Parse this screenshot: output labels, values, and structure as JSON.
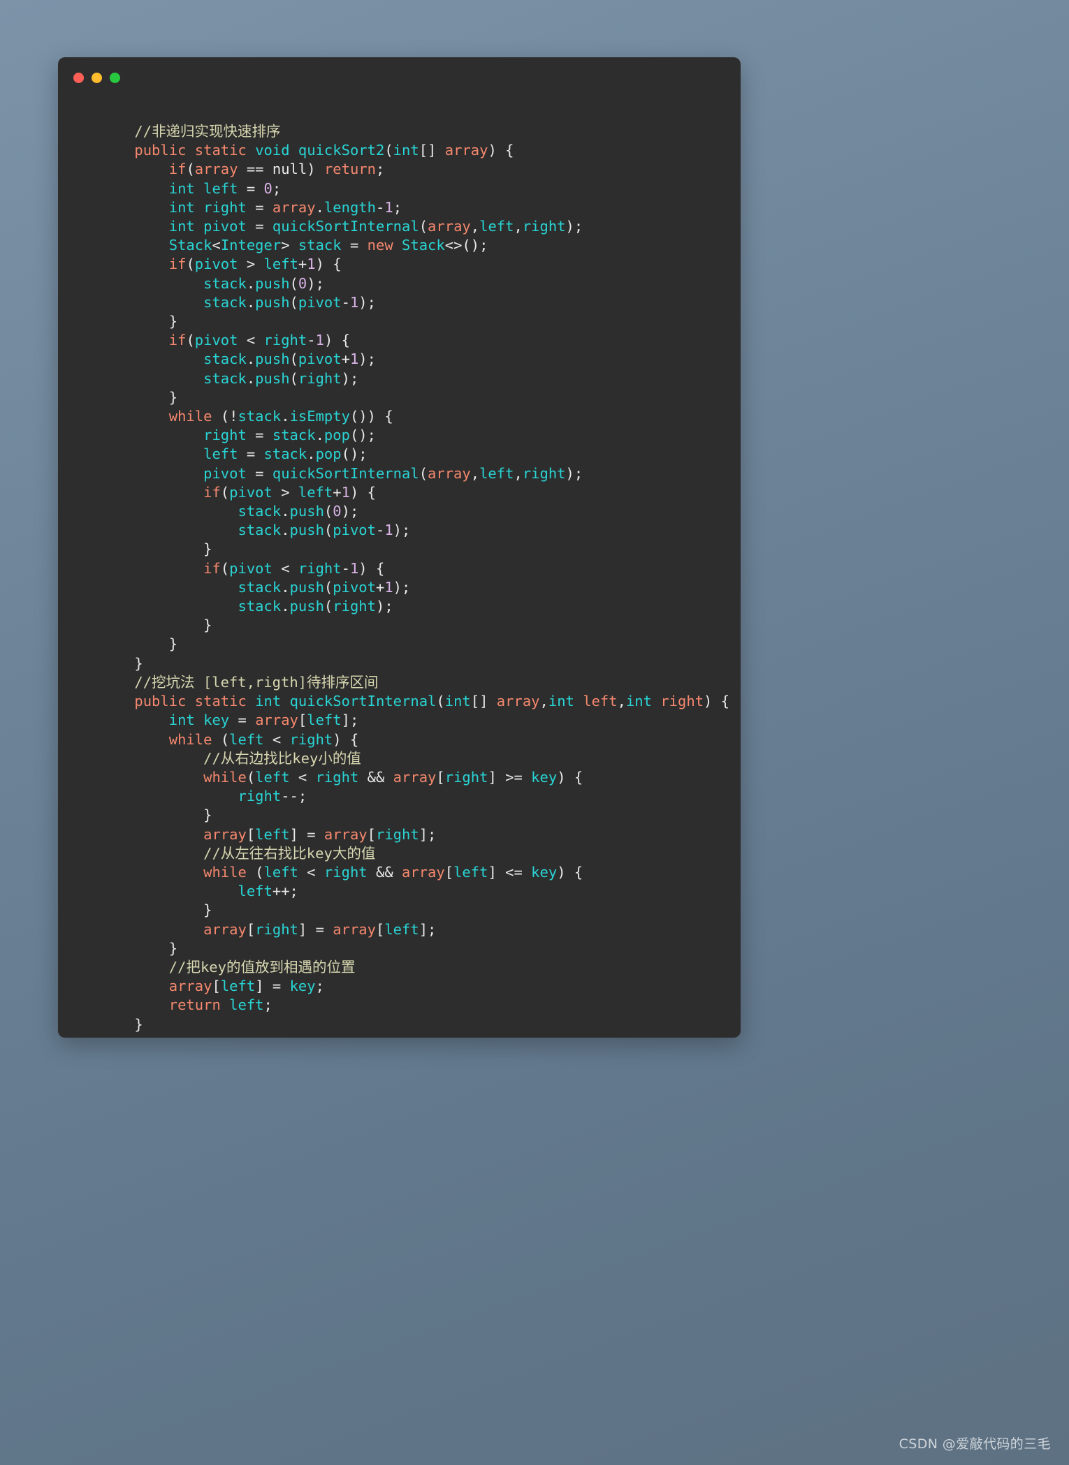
{
  "window": {
    "background_color": "#6e8599",
    "panel_color": "#2d2d2d",
    "traffic_lights": [
      {
        "name": "close",
        "color": "#ff5f57"
      },
      {
        "name": "minimize",
        "color": "#febc2e"
      },
      {
        "name": "maximize",
        "color": "#28c840"
      }
    ]
  },
  "theme": {
    "keyword": "#f5886e",
    "identifier": "#2ad4d4",
    "number": "#d9b3e6",
    "operator": "#e8e8e8",
    "comment": "#d6d6b0",
    "background": "#2d2d2d"
  },
  "code": {
    "language": "java",
    "text": "    //非递归实现快速排序\n    public static void quickSort2(int[] array) {\n        if(array == null) return;\n        int left = 0;\n        int right = array.length-1;\n        int pivot = quickSortInternal(array,left,right);\n        Stack<Integer> stack = new Stack<>();\n        if(pivot > left+1) {\n            stack.push(0);\n            stack.push(pivot-1);\n        }\n        if(pivot < right-1) {\n            stack.push(pivot+1);\n            stack.push(right);\n        }\n        while (!stack.isEmpty()) {\n            right = stack.pop();\n            left = stack.pop();\n            pivot = quickSortInternal(array,left,right);\n            if(pivot > left+1) {\n                stack.push(0);\n                stack.push(pivot-1);\n            }\n            if(pivot < right-1) {\n                stack.push(pivot+1);\n                stack.push(right);\n            }\n        }\n    }\n    //挖坑法 [left,rigth]待排序区间\n    public static int quickSortInternal(int[] array,int left,int right) {\n        int key = array[left];\n        while (left < right) {\n            //从右边找比key小的值\n            while(left < right && array[right] >= key) {\n                right--;\n            }\n            array[left] = array[right];\n            //从左往右找比key大的值\n            while (left < right && array[left] <= key) {\n                left++;\n            }\n            array[right] = array[left];\n        }\n        //把key的值放到相遇的位置\n        array[left] = key;\n        return left;\n    }"
  },
  "watermark": {
    "text": "CSDN @爱敲代码的三毛"
  }
}
